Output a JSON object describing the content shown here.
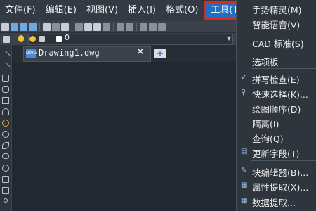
{
  "menubar": {
    "items": [
      "文件(F)",
      "编辑(E)",
      "视图(V)",
      "插入(I)",
      "格式(O)",
      "工具(T)"
    ],
    "active_index": 5
  },
  "layer_toolbar": {
    "current_layer": "0"
  },
  "document_tab": {
    "icon_text": "DWG",
    "name": "Drawing1.dwg",
    "close_glyph": "✕",
    "new_tab_glyph": "+"
  },
  "tools_menu": {
    "items": [
      {
        "label": "手势精灵(M)",
        "icon": ""
      },
      {
        "label": "智能语音(V)",
        "icon": ""
      },
      {
        "label": "CAD 标准(S)",
        "icon": ""
      },
      {
        "label": "选项板",
        "icon": ""
      },
      {
        "label": "拼写检查(E)",
        "icon": "spellcheck-icon"
      },
      {
        "label": "快速选择(K)...",
        "icon": "quick-select-icon"
      },
      {
        "label": "绘图顺序(D)",
        "icon": ""
      },
      {
        "label": "隔离(I)",
        "icon": ""
      },
      {
        "label": "查询(Q)",
        "icon": ""
      },
      {
        "label": "更新字段(T)",
        "icon": "update-field-icon"
      },
      {
        "label": "块编辑器(B)...",
        "icon": "block-editor-icon"
      },
      {
        "label": "属性提取(X)...",
        "icon": "attribute-extract-icon"
      },
      {
        "label": "数据提取...",
        "icon": "data-extract-icon"
      }
    ]
  },
  "colors": {
    "menubar_bg": "#333a44",
    "active_menu_bg": "#1f6fc4",
    "highlight_border": "#e0271f",
    "canvas_bg": "#212830"
  }
}
